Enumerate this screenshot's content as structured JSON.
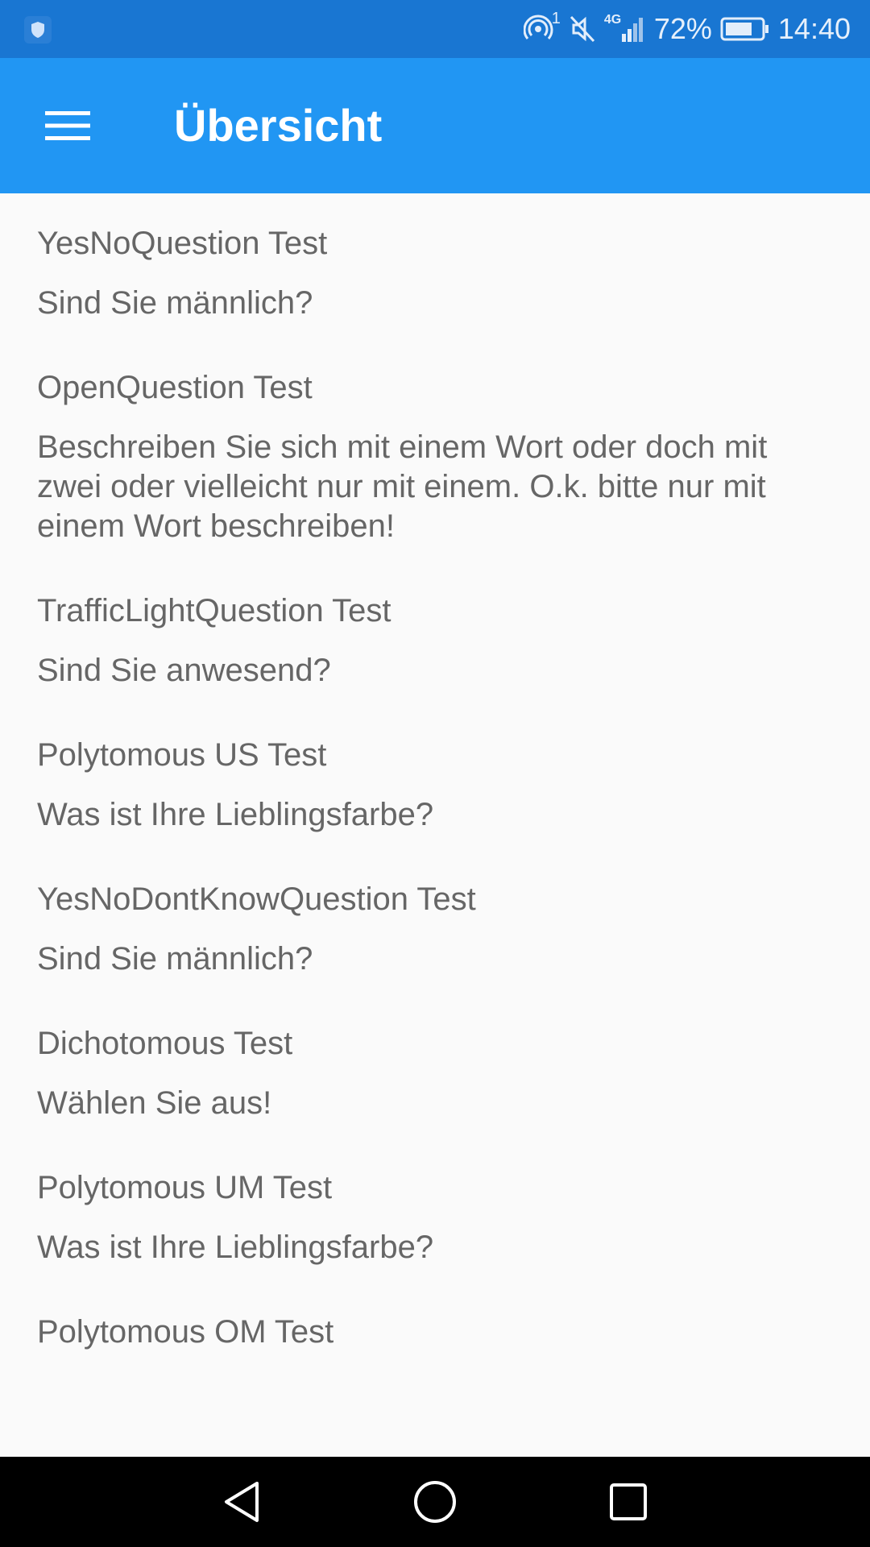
{
  "status_bar": {
    "left_icon": "shield-app-icon",
    "icons": [
      "hotspot-icon",
      "mute-icon",
      "signal-4g-icon",
      "battery-icon"
    ],
    "hotspot_count": "1",
    "network": "4G",
    "battery_percent": "72%",
    "time": "14:40"
  },
  "app_bar": {
    "menu_icon": "hamburger-menu-icon",
    "title": "Übersicht",
    "color": "#2196f3"
  },
  "list": {
    "items": [
      {
        "title": "YesNoQuestion Test",
        "question": "Sind Sie männlich?"
      },
      {
        "title": "OpenQuestion Test",
        "question": "Beschreiben Sie sich mit einem Wort oder doch mit zwei oder vielleicht nur mit einem. O.k. bitte nur mit einem Wort beschreiben!"
      },
      {
        "title": "TrafficLightQuestion Test",
        "question": "Sind Sie anwesend?"
      },
      {
        "title": "Polytomous US Test",
        "question": "Was ist Ihre Lieblingsfarbe?"
      },
      {
        "title": "YesNoDontKnowQuestion Test",
        "question": "Sind Sie männlich?"
      },
      {
        "title": "Dichotomous Test",
        "question": "Wählen Sie aus!"
      },
      {
        "title": "Polytomous UM Test",
        "question": "Was ist Ihre Lieblingsfarbe?"
      },
      {
        "title": "Polytomous OM Test",
        "question": ""
      }
    ]
  },
  "nav_bar": {
    "buttons": [
      "back-triangle-icon",
      "home-circle-icon",
      "recents-square-icon"
    ]
  }
}
